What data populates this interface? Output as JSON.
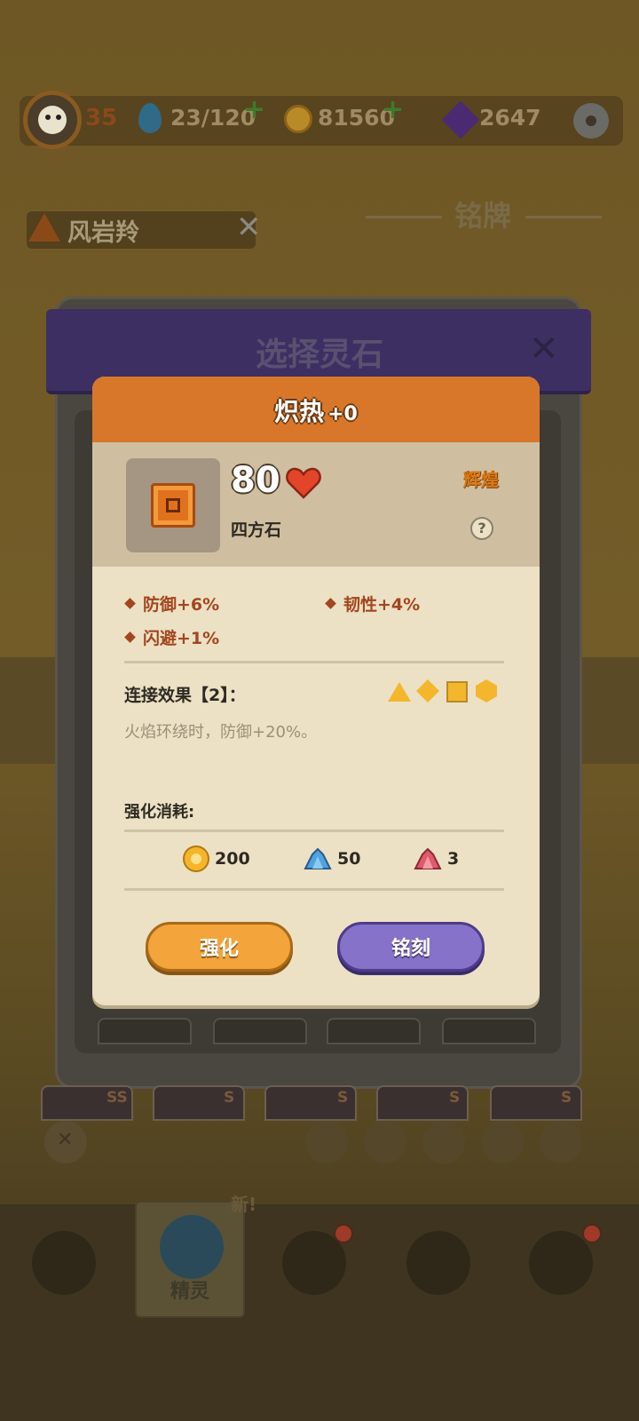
{
  "topbar": {
    "level": "35",
    "stamina": "23/120",
    "coins": "81560",
    "gems": "2647"
  },
  "region": {
    "name": "风岩羚"
  },
  "plaque": {
    "title": "铭牌"
  },
  "dialog": {
    "title": "选择灵石",
    "card": {
      "name": "炽热",
      "level": "+0",
      "power": "80",
      "stone_name": "四方石",
      "rarity": "辉煌",
      "help": "?",
      "attributes": [
        "防御+6%",
        "韧性+4%",
        "闪避+1%"
      ],
      "link_title": "连接效果【2】：",
      "link_desc": "火焰环绕时，防御+20%。",
      "link_shapes": [
        "triangle",
        "diamond",
        "square",
        "hexagon"
      ],
      "cost_title": "强化消耗:",
      "costs": {
        "coin": "200",
        "blue_crystal": "50",
        "red_crystal": "3"
      },
      "buttons": {
        "enhance": "强化",
        "engrave": "铭刻"
      }
    }
  },
  "spirit_tags": [
    "SS",
    "S",
    "S",
    "S",
    "S"
  ],
  "nav": {
    "spirit_label": "精灵",
    "new_label": "新!"
  },
  "colors": {
    "card_header": "#d8772a",
    "enhance_button": "#f3a43b",
    "engrave_button": "#8672c9",
    "rarity": "#e07a10"
  }
}
